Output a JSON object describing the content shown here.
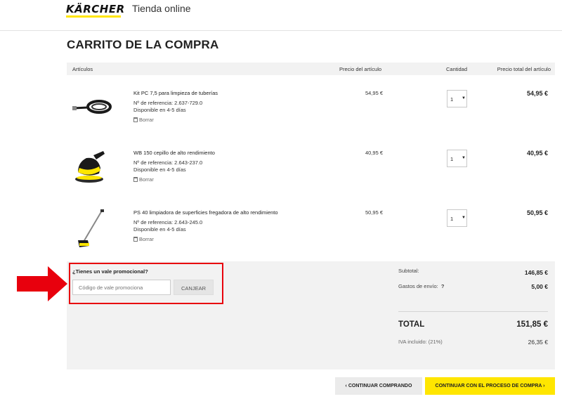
{
  "header": {
    "logo_text": "KÄRCHER",
    "store_name": "Tienda online"
  },
  "page_title": "CARRITO DE LA COMPRA",
  "table": {
    "columns": [
      "Artículos",
      "Precio del artículo",
      "Cantidad",
      "Precio total del artículo"
    ]
  },
  "items": [
    {
      "name": "Kit PC 7,5 para limpieza de tuberías",
      "ref": "Nº de referencia: 2.637-729.0",
      "availability": "Disponible en 4-5 días",
      "delete_label": "Borrar",
      "price": "54,95 €",
      "qty": "1",
      "total": "54,95 €",
      "image_icon": "hose-kit-icon"
    },
    {
      "name": "WB 150 cepillo de alto rendimiento",
      "ref": "Nº de referencia: 2.643-237.0",
      "availability": "Disponible en 4-5 días",
      "delete_label": "Borrar",
      "price": "40,95 €",
      "qty": "1",
      "total": "40,95 €",
      "image_icon": "brush-icon"
    },
    {
      "name": "PS 40 limpiadora de superficies fregadora de alto rendimiento",
      "ref": "Nº de referencia: 2.643-245.0",
      "availability": "Disponible en 4-5 días",
      "delete_label": "Borrar",
      "price": "50,95 €",
      "qty": "1",
      "total": "50,95 €",
      "image_icon": "surface-cleaner-icon"
    }
  ],
  "promo": {
    "label": "¿Tienes un vale promocional?",
    "placeholder": "Código de vale promociona",
    "button": "CANJEAR"
  },
  "summary": {
    "subtotal_label": "Subtotal:",
    "subtotal": "146,85 €",
    "shipping_label": "Gastos de envío:",
    "shipping_help": "?",
    "shipping": "5,00 €",
    "total_label": "TOTAL",
    "total": "151,85 €",
    "iva_label": "IVA incluido: (21%)",
    "iva": "26,35 €"
  },
  "buttons": {
    "continue": "‹  CONTINUAR COMPRANDO",
    "checkout": "CONTINUAR CON EL PROCESO DE COMPRA  ›"
  },
  "colors": {
    "brand_yellow": "#ffe600",
    "highlight_red": "#e8000d"
  }
}
